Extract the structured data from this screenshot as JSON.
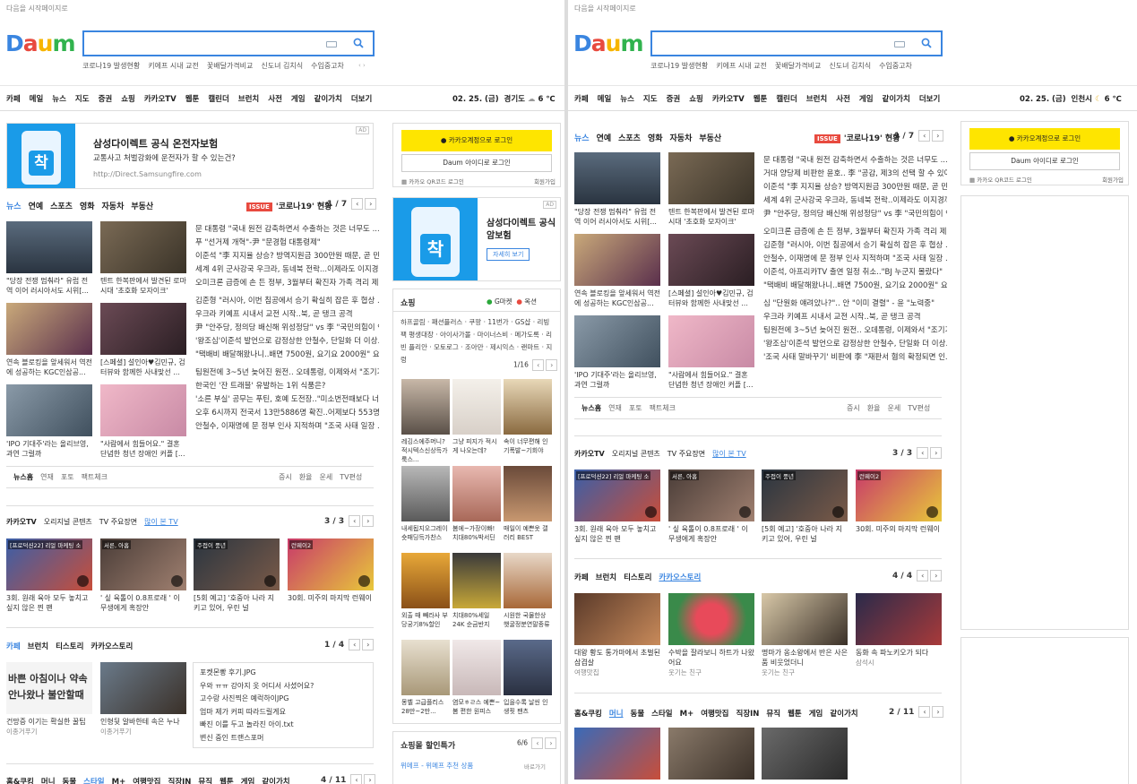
{
  "start_page": "다음을 시작페이지로",
  "logo": "Daum",
  "keywords": [
    "코로나19 발생현황",
    "키에프 시내 교전",
    "꽃배달가격비교",
    "신도녀 김치식",
    "수입중고차"
  ],
  "menu": [
    "카페",
    "메일",
    "뉴스",
    "지도",
    "증권",
    "쇼핑",
    "카카오TV",
    "웹툰",
    "캘린더",
    "브런치",
    "사전",
    "게임",
    "같이가치",
    "더보기"
  ],
  "left": {
    "date": "02. 25. (금)",
    "region": "경기도",
    "temp": "6 ℃",
    "ad": {
      "title": "삼성다이렉트 공식 온전자보험",
      "desc": "교통사고 처벌강화에 운전자가 할 수 있는건?",
      "url": "http://Direct.Samsungfire.com",
      "tag": "AD"
    },
    "news_tabs": [
      "뉴스",
      "연예",
      "스포츠",
      "영화",
      "자동차",
      "부동산"
    ],
    "issue": {
      "badge": "ISSUE",
      "text": "'코로나19' 현황",
      "page": "1 / 7"
    },
    "news_thumbs": [
      "\"당장 전쟁 멈춰라\" 유럽 전역 이어 러시아서도 시위[...",
      "텐트 한복판에서 발견된 로마시대 '초호화 모자이크'",
      "연속 블로킹을 앞세워서 역전에 성공하는 KGC인삼공...",
      "[스페셜] 설인아♥김민규, 검터뷰와 함께한 사내맞선 ...",
      "'IPO 기대주'라는 올리브영, 과연 그럴까",
      "\"사람에서 힘들어요.\" 결혼 단념한 청년 장애인 커플 [..."
    ],
    "news_list": [
      [
        "문 대통령 \"국내 원전 감축하면서 수출하는 것은 너무도 ...",
        "푸 \"선거제 개혁\"-尹 \"문경험 대통령제\"",
        "이준석 \"李 지지율 상승? 방역지원금 300만원 때문, 곧 민...",
        "세계 4위 군사강국 우크라, 동네북 전락...이제라도 이지경까지",
        "오미크론 급증에 손 든 정부, 3월부터 확진자 가족 격리 제외"
      ],
      [
        "김준형 \"러시아, 이번 침공에서 승기 확실히 잡은 후 협상 ...",
        "우크라 키예프 시내서 교전 시작..북, 곧 탱크 공격",
        "尹 \"안주당, 정의당 배신해 위성정당\" vs 李 \"국민의힘이 연...",
        "'왕조심'이준석 발언으로 감정상한 안철수, 단일화 더 이상...",
        "\"택배비 배달해왔나니..배면 7500원, 요기요 2000원\" 요지..."
      ],
      [
        "팀원전에 3~5년 늦어진 원전.. 오데통령, 이제와서 \"조기가...",
        "한국인 '잔 트래블' 유발하는 1위 식품은?",
        "'소른 부실' 공무는 푸틴, 호예 도전장..\"미소번전때보다 너 ...",
        "오후 6시까지 전국서 13만5886명 확진..어제보다 553명 많아",
        "안철수, 이재명에 문 정부 인사 지적하며 \"조국 사태 일장 ..."
      ]
    ],
    "news_sub": [
      "뉴스홈",
      "연재",
      "포토",
      "팩트체크"
    ],
    "news_sub_right": [
      "증시",
      "환율",
      "운세",
      "TV편성"
    ],
    "kakaotv": {
      "tabs": [
        "카카오TV",
        "오리지널 콘텐츠",
        "TV 주요장면",
        "많이 본 TV"
      ],
      "page": "3 / 3"
    },
    "videos": [
      {
        "ov": "[프로덕션22] 리얼 마케팅 소",
        "cap": "3회. 원래 육아 모두 놓치고 싶지 않은 찐 팬"
      },
      {
        "ov": "서른, 아홉",
        "cap": "' 싶 육톨이 0.8프로래 ' 이무생에게 혹장안"
      },
      {
        "ov": "주접이 풍년",
        "cap": "[5회 예고] '호중아 나라 지키고 있어, 우린 널"
      },
      {
        "ov": "런웨이2",
        "cap": "30회. 미주의 마지막 런웨이"
      }
    ],
    "cafe": {
      "tabs": [
        "카페",
        "브런치",
        "티스토리",
        "카카오스토리"
      ],
      "page": "1 / 4"
    },
    "cafe_items": [
      {
        "img": "바쁜 아침이나 약속 안나왔나 불안할때",
        "cap": "건망증 이기는 확실한 꿀팁",
        "src": "이종거푸기"
      },
      {
        "cap": "인형뒷 알바한테 속은 누나",
        "src": "이종거푸기"
      }
    ],
    "cafe_list": [
      "포켓몬빵 후기.JPG",
      "우와 ㅠㅠ 강아지 옷 어디서 사셨어요?",
      "고수랑 사진찍은 예럭하이JPG",
      "엄마 제가 커피 따라드릴게요",
      "빠진 이를 두고 놀라진 아이.txt",
      "변신 중인 트랜스포머"
    ],
    "bottom_tabs": [
      "홈&쿠킹",
      "머니",
      "동물",
      "스타일",
      "M+",
      "여행맛집",
      "직장IN",
      "뮤직",
      "웹툰",
      "게임",
      "같이가치"
    ],
    "bottom_page": "4 / 11",
    "login": {
      "kakao": "카카오계정으로 로그인",
      "daum": "Daum 아이디로 로그인",
      "qr": "카카오 QR코드 로그인",
      "join": "회원가입"
    },
    "side_ad": {
      "title": "삼성다이렉트 공식 암보험",
      "btn": "자세히 보기",
      "tag": "AD"
    },
    "shopping": {
      "title": "쇼핑",
      "gmarket": "G마켓",
      "auction": "옥션",
      "cats": "하프골림 · 패션플러스 · 쿠팡 · 11번가 · GS샵 · 리빙팩 평생대장 · 아이사가몰 · 마이너스비 · 메가도록 · 리빈 플리안 · 모토로그 · 조아만 · 제시익스 · 랜마트 · 지렁",
      "page": "1/16"
    },
    "shop_items": [
      "레깅스에주머니? 적시텍스신상득가 룩스...",
      "그냥 피지가 적시게 나오는데?",
      "속이 너무편해 인기폭발~기회야",
      "내세됩지오그레이 숏패딩득가찬스",
      "봄에~가장이빠! 치대80%박서딘",
      "매일이 예쁜옷 갤러리 BEST",
      "외출 때 빼라사 부당궁기8%할인",
      "치대80%세일 24K 순금반지",
      "시원한 국물한상 햇굴정분연말종류",
      "몽벨 고급플리스 28만~2만...",
      "염모ㅎㄹ스 예쁜~봄 편한 원피스",
      "입을수록 날씬 인생핏 팬츠"
    ],
    "sale": {
      "title": "쇼핑몰 할인특가",
      "page": "6/6",
      "link": "위메프 - 위메프 추천 상품",
      "more": "바로가기"
    }
  },
  "right": {
    "date": "02. 25. (금)",
    "region": "인천시",
    "temp": "6 ℃",
    "news_thumbs": [
      "\"당장 전쟁 멈춰라\" 유럽 전역 이어 러시아서도 시위[...",
      "텐트 한복판에서 발견된 로마시대 '초호화 모자이크'",
      "연속 블로킹을 앞세워서 역전에 성공하는 KGC인삼공...",
      "[스페셜] 설인아♥김민규, 검터뷰와 함께한 사내맞선 ...",
      "'IPO 기대주'라는 올리브영, 과연 그럴까",
      "\"사람에서 힘들어요.\" 결혼 단념한 청년 장애인 커플 [..."
    ],
    "news_list": [
      [
        "문 대통령 \"국내 원전 감축하면서 수출하는 것은 너무도 ...",
        "거대 양당제 비판한 윤호.. 李 \"공감, 제3의 선택 할 수 있어...",
        "이준석 \"李 지지율 상승? 방역지원금 300만원 때문, 곧 민...",
        "세계 4위 군사강국 우크라, 동네북 전락..이제라도 이지경까지",
        "尹 \"안주당, 정의당 배신해 위성정당\" vs 李 \"국민의힘이 연..."
      ],
      [
        "오미크론 급증에 손 든 정부, 3월부터 확진자 가족 격리 제외",
        "김준형 \"러시아, 이번 침공에서 승기 확실히 잡은 후 협상 ...",
        "안철수, 이재명에 문 정부 인사 지적하며 \"조국 사태 일장 ...",
        "이준석, 아프리카TV 출연 일정 취소..\"BJ 누군지 몰랐다\"",
        "\"택배비 배달해왔나니..배면 7500원, 요기요 2000원\" 요지..."
      ],
      [
        "심 \"단원화 얘려았나?\".. 안 \"이미 결렬\" - 윤 \"노력중\"",
        "우크라 키예프 시내서 교전 시작..북, 곧 탱크 공격",
        "팀원전에 3~5년 늦어진 원전.. 오데통령, 이제와서 \"조기가...",
        "'왕조심'이준석 발언으로 감정상한 안철수, 단일화 더 이상...",
        "'조국 사태 말바꾸기' 비판에 李 \"재판서 혐의 확정되면 인..."
      ]
    ],
    "videos": [
      {
        "ov": "[프로덕션22] 리얼 마케팅 소",
        "cap": "3회. 원래 육아 모두 놓치고 싶지 않은 찐 팬"
      },
      {
        "ov": "서른, 아홉",
        "cap": "' 싶 육톨이 0.8프로래 ' 이무생에게 혹장안"
      },
      {
        "ov": "주접이 풍년",
        "cap": "[5회 예고] '호중아 나라 지키고 있어, 우린 널"
      },
      {
        "ov": "런웨이2",
        "cap": "30회. 미주의 마지막 런웨이"
      }
    ],
    "cafe_page": "4 / 4",
    "story_items": [
      {
        "cap": "대왕 황도 통가마에서 초벌된 삼겹살",
        "src": "여행맛집"
      },
      {
        "cap": "수박을 잘라보니 하트가 나왔어요",
        "src": "웃기는 친구"
      },
      {
        "cap": "명마가 옹소왕에서 반은 사은품 비웃었더니",
        "src": "웃기는 친구"
      },
      {
        "cap": "동화 속 파노키오가 되다",
        "src": "삼석시"
      }
    ],
    "bottom_page": "2 / 11"
  },
  "colors": {
    "accent": "#3a85e0",
    "issue": "#e84a3f",
    "kakao": "#fee500"
  }
}
